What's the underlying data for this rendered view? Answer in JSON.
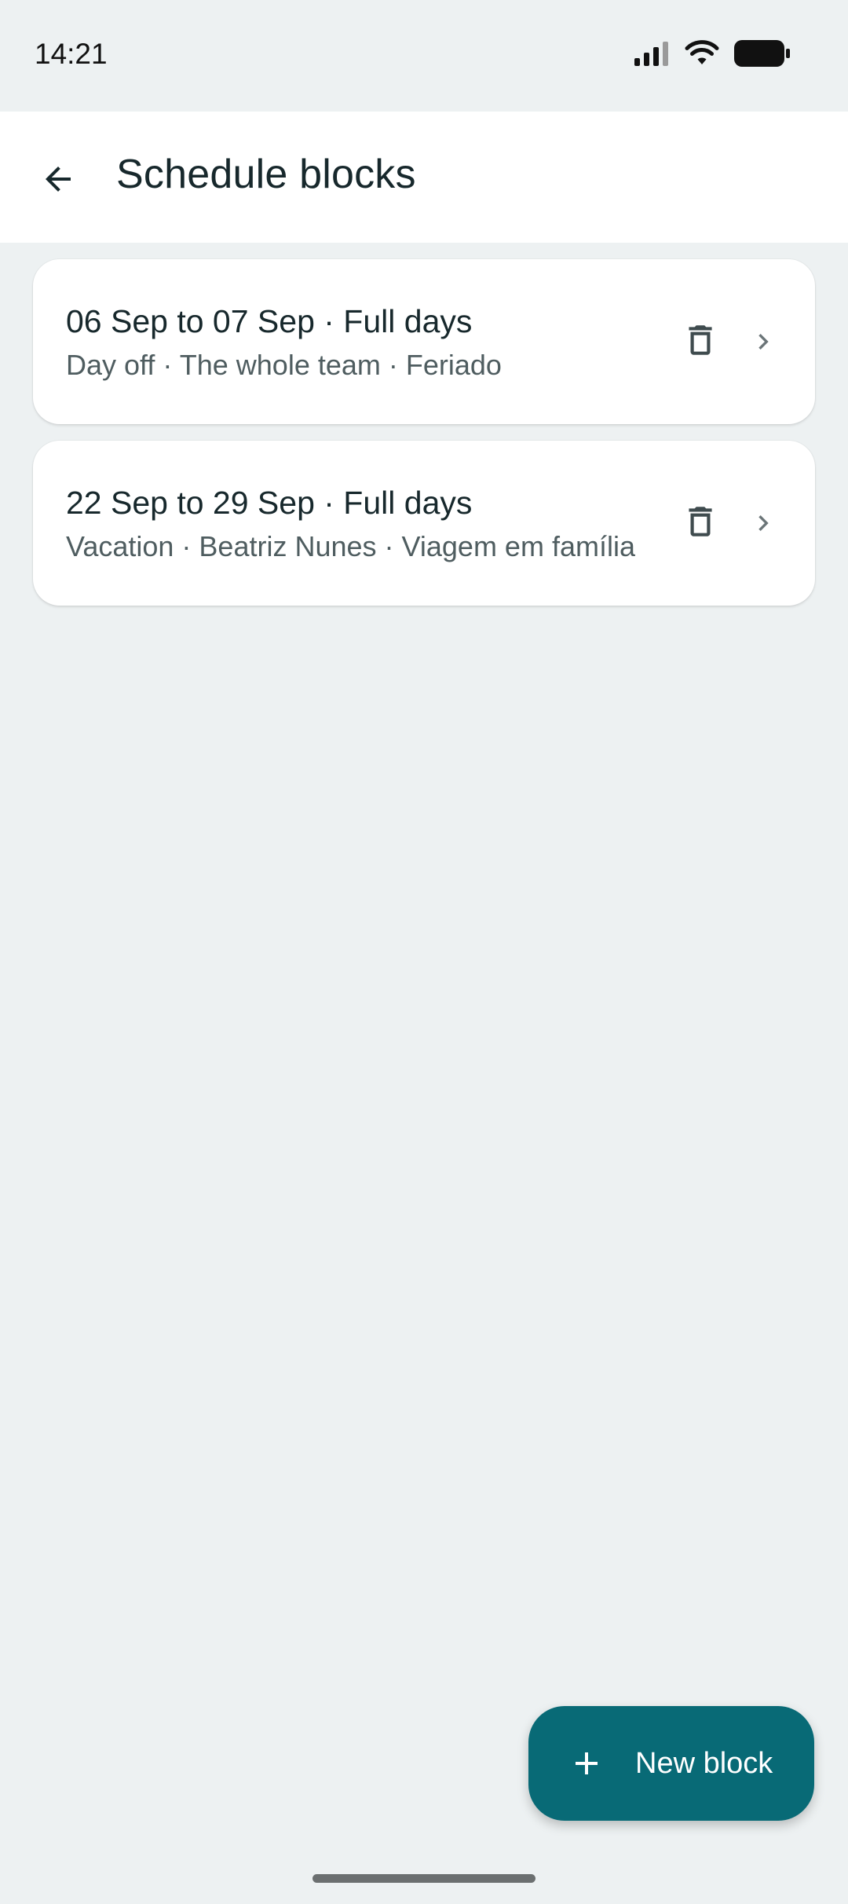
{
  "status_bar": {
    "time": "14:21",
    "icons": [
      "signal-icon",
      "wifi-icon",
      "battery-icon"
    ]
  },
  "app_bar": {
    "back_icon": "arrow-back-icon",
    "title": "Schedule blocks"
  },
  "blocks": [
    {
      "title": "06 Sep to 07 Sep · Full days",
      "subtitle": "Day off · The whole team · Feriado",
      "delete_icon": "trash-icon",
      "open_icon": "chevron-right-icon"
    },
    {
      "title": "22 Sep to 29 Sep · Full days",
      "subtitle": "Vacation · Beatriz Nunes · Viagem em família",
      "delete_icon": "trash-icon",
      "open_icon": "chevron-right-icon"
    }
  ],
  "fab": {
    "icon": "plus-icon",
    "label": "New block"
  },
  "colors": {
    "background": "#edf1f2",
    "surface": "#ffffff",
    "accent": "#086a76",
    "text_primary": "#17282c",
    "text_secondary": "#4f5d60"
  }
}
